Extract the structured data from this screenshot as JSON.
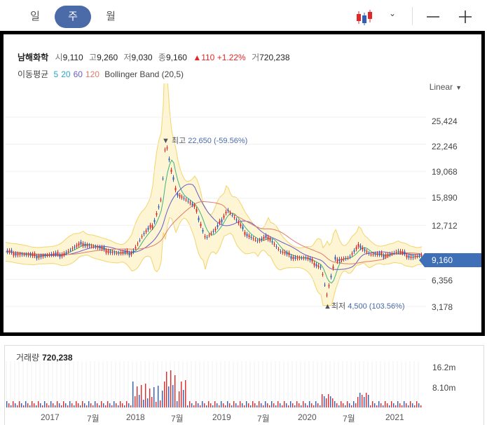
{
  "tabs": [
    {
      "label": "일",
      "active": false
    },
    {
      "label": "주",
      "active": true
    },
    {
      "label": "월",
      "active": false
    }
  ],
  "toolbar": {
    "chart_type_icon": "candlestick-icon",
    "zoom_out_icon": "minus-icon",
    "zoom_in_icon": "plus-icon"
  },
  "stock": {
    "name": "남해화학",
    "open_label": "시",
    "open": "9,110",
    "high_label": "고",
    "high": "9,260",
    "low_label": "저",
    "low": "9,030",
    "close_label": "종",
    "close": "9,160",
    "change_arrow": "▲",
    "change": "110",
    "change_pct": "+1.22%",
    "volume_label": "거",
    "volume": "720,238"
  },
  "indicators": {
    "ma_label": "이동평균",
    "ma": [
      {
        "period": "5",
        "color": "#2aa6c8"
      },
      {
        "period": "20",
        "color": "#2aa6c8"
      },
      {
        "period": "60",
        "color": "#6a5bc4"
      },
      {
        "period": "120",
        "color": "#e27a6a"
      }
    ],
    "bollinger": "Bollinger Band (20,5)"
  },
  "scale": {
    "label": "Linear",
    "caret": "▼"
  },
  "price_axis": [
    "25,424",
    "22,246",
    "19,068",
    "15,890",
    "12,712",
    "6,356",
    "3,178"
  ],
  "current_price": "9,160",
  "annotations": {
    "high": {
      "marker": "▼",
      "label": "최고",
      "value": "22,650 (-59.56%)"
    },
    "low": {
      "marker": "▲",
      "label": "최저",
      "value": "4,500 (103.56%)"
    }
  },
  "volume": {
    "label": "거래량",
    "value": "720,238",
    "axis": [
      "16.2m",
      "8.10m"
    ]
  },
  "x_axis": [
    "2017",
    "7월",
    "2018",
    "7월",
    "2019",
    "7월",
    "2020",
    "7월",
    "2021"
  ],
  "colors": {
    "up": "#e02828",
    "down": "#2f5fb8",
    "band_fill": "#fdf5d3",
    "band_line": "#f3d46b",
    "accent": "#4a6aa8"
  }
}
